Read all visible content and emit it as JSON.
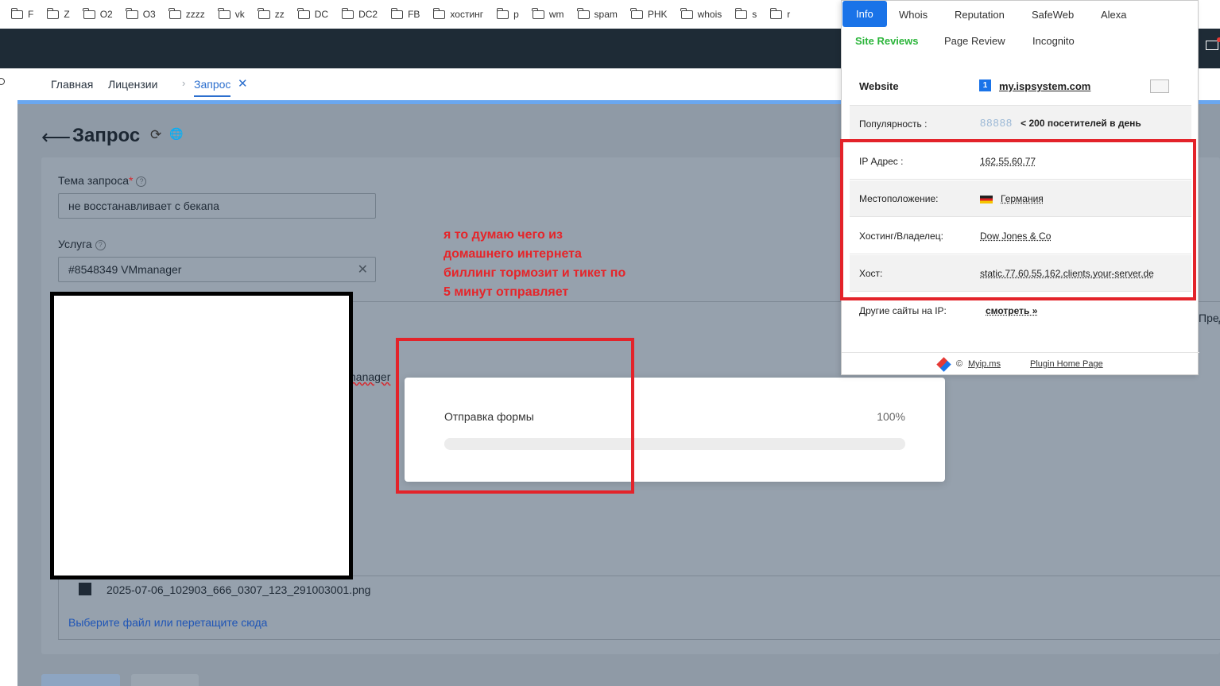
{
  "bookmarks": [
    "F",
    "Z",
    "O2",
    "O3",
    "zzzz",
    "vk",
    "zz",
    "DC",
    "DC2",
    "FB",
    "хостинг",
    "p",
    "wm",
    "spam",
    "PHK",
    "whois",
    "s",
    "r"
  ],
  "nav": {
    "tabs": [
      "Главная",
      "Лицензии",
      "Запрос"
    ],
    "close_glyph": "✕",
    "separator": "›"
  },
  "page": {
    "back_glyph": "⟵",
    "title": "Запрос",
    "refresh_glyph": "⟳",
    "globe_glyph": "🌐"
  },
  "form": {
    "subject_label": "Тема запроса",
    "subject_required": "*",
    "subject_value": "не восстанавливает с бекапа",
    "service_label": "Услуга",
    "service_value": "#8548349 VMmanager",
    "clear_glyph": "✕",
    "help_glyph": "?",
    "service_fragment": "nanager",
    "file_name": "2025-07-06_102903_666_0307_123_291003001.png",
    "upload_link": "Выберите файл или перетащите сюда",
    "right_cut_text": "Пред"
  },
  "annotation": {
    "text": "я то думаю чего из домашнего интернета биллинг тормозит и тикет по 5 минут отправляет",
    "color": "#e5252a"
  },
  "modal": {
    "title": "Отправка формы",
    "percent_label": "100%",
    "progress": 1.0
  },
  "plugin": {
    "tabs": [
      "Info",
      "Whois",
      "Reputation",
      "SafeWeb",
      "Alexa"
    ],
    "tabs2": [
      "Site Reviews",
      "Page Review",
      "Incognito"
    ],
    "website_label": "Website",
    "website_value": "my.ispsystem.com",
    "site_icon_text": "1",
    "rows": [
      {
        "k": "Популярность :",
        "v": "< 200 посетителей в день",
        "people": "88888"
      },
      {
        "k": "IP Адрес :",
        "v": "162.55.60.77"
      },
      {
        "k": "Местоположение:",
        "v": "Германия"
      },
      {
        "k": "Хостинг/Владелец:",
        "v": "Dow Jones & Co"
      },
      {
        "k": "Хост:",
        "v": "static.77.60.55.162.clients.your-server.de"
      },
      {
        "k": "Другие сайты на IP:",
        "v": "смотреть »"
      }
    ],
    "footer": {
      "copyright": "©",
      "site": "Myip.ms",
      "home": "Plugin Home Page"
    }
  },
  "colors": {
    "accent": "#1a73e8",
    "annotation_red": "#e3232a",
    "dark_header": "#1e2b36"
  }
}
